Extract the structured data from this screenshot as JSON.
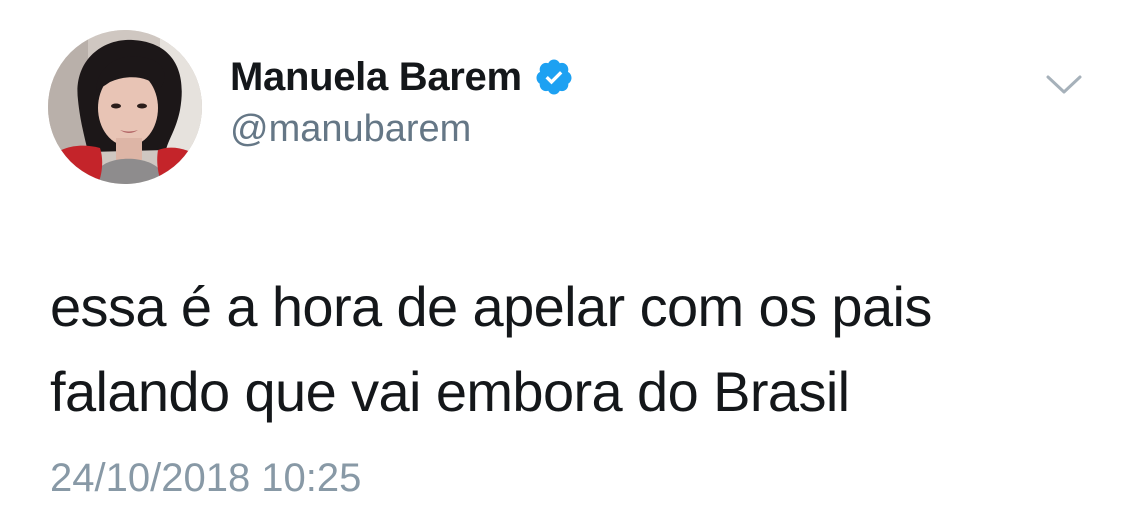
{
  "user": {
    "display_name": "Manuela Barem",
    "handle": "@manubarem",
    "verified": true,
    "verified_icon": "verified-badge-icon",
    "avatar": "profile-photo"
  },
  "menu": {
    "icon": "chevron-down-icon"
  },
  "tweet": {
    "text_lines": [
      "essa é a hora de apelar com os pais",
      "falando que vai embora do Brasil"
    ],
    "timestamp": "24/10/2018 10:25"
  },
  "colors": {
    "name": "#14171a",
    "handle": "#657786",
    "timestamp": "#8899a6",
    "verified": "#1da1f2",
    "caret": "#a6b1ba"
  }
}
